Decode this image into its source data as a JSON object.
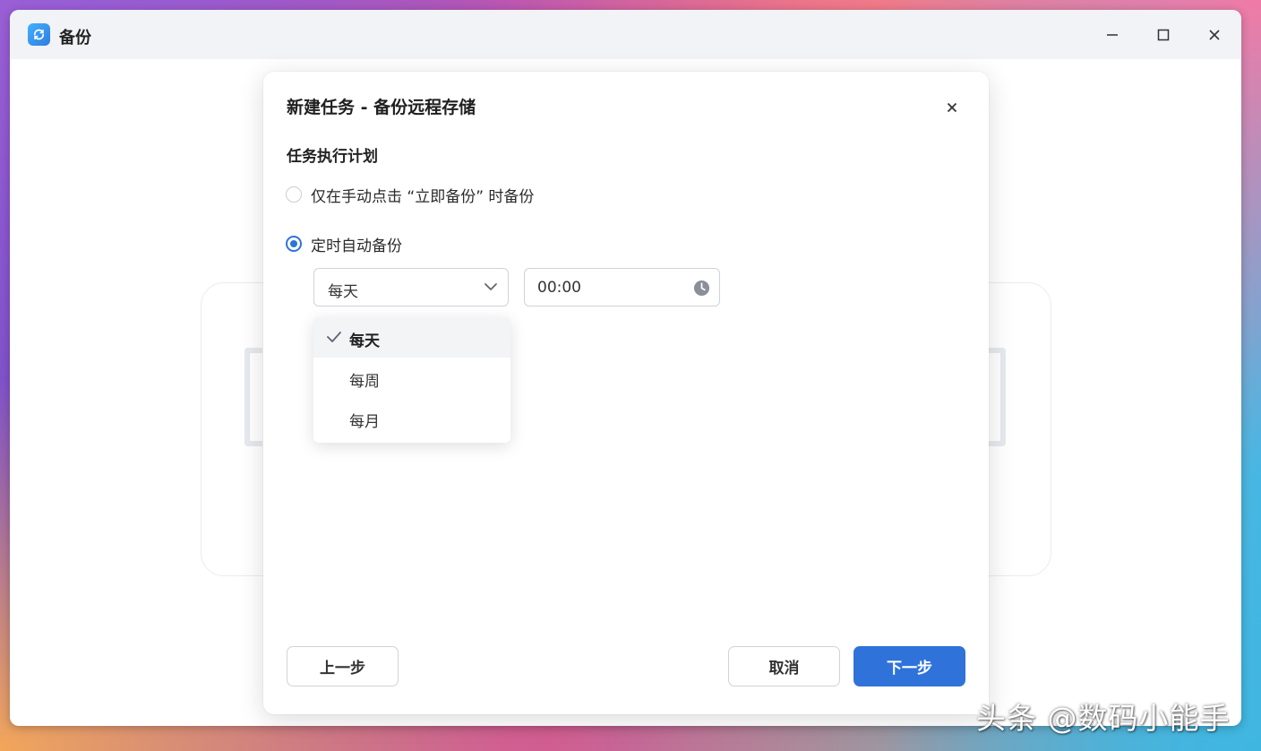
{
  "window": {
    "title": "备份",
    "controls": {
      "minimize": "minimize-icon",
      "maximize": "maximize-icon",
      "close": "close-icon"
    }
  },
  "dialog": {
    "title": "新建任务 - 备份远程存储",
    "section_label": "任务执行计划",
    "options": [
      {
        "label": "仅在手动点击 “立即备份” 时备份",
        "checked": false
      },
      {
        "label": "定时自动备份",
        "checked": true
      }
    ],
    "frequency": {
      "selected": "每天",
      "options": [
        "每天",
        "每周",
        "每月"
      ]
    },
    "time": {
      "value": "00:00"
    },
    "buttons": {
      "prev": "上一步",
      "cancel": "取消",
      "next": "下一步"
    }
  },
  "colors": {
    "accent": "#2f73da",
    "border": "#cfd3da"
  },
  "watermark": "头条 @数码小能手"
}
